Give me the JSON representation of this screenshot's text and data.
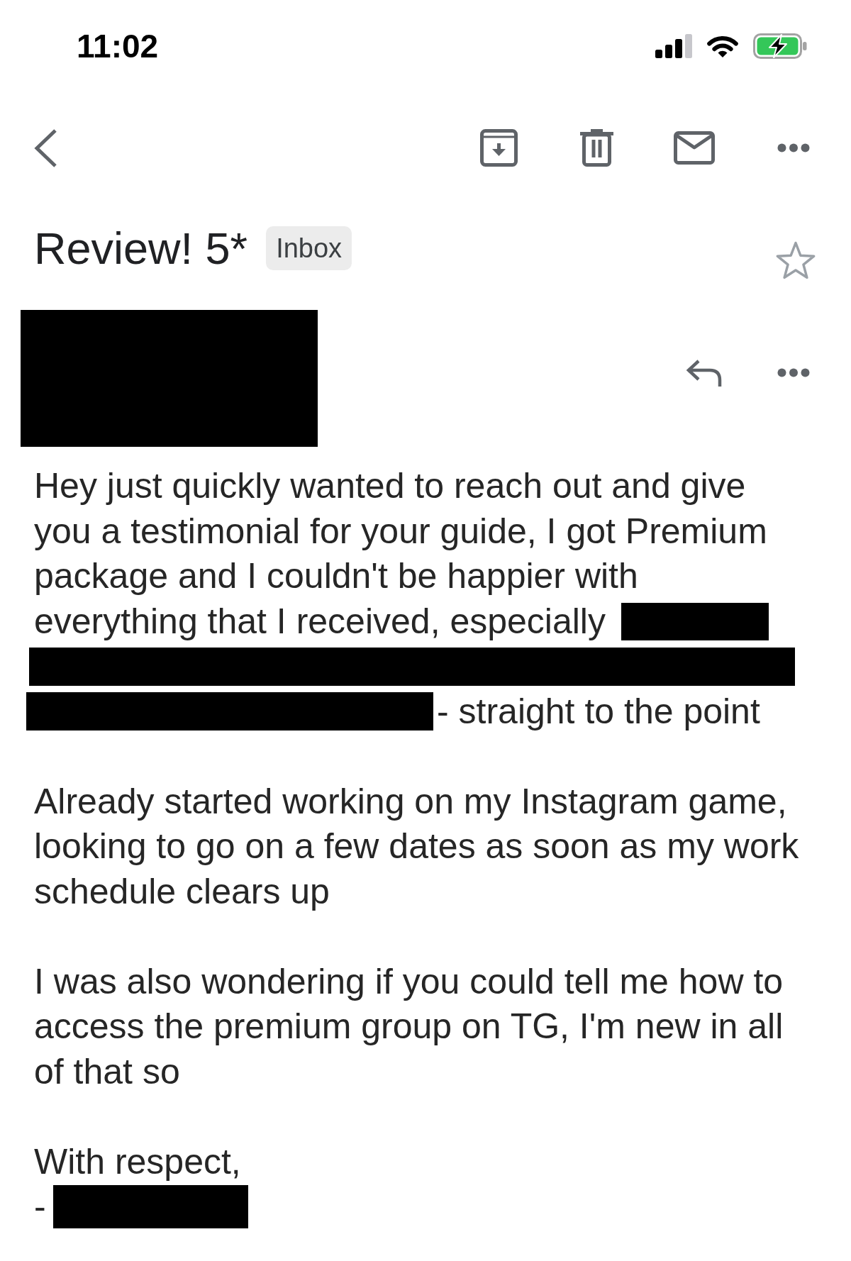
{
  "status_bar": {
    "time": "11:02"
  },
  "header": {
    "subject": "Review! 5*",
    "label": "Inbox",
    "starred": false
  },
  "message": {
    "paragraphs": [
      {
        "kind": "redacted",
        "text_before": "Hey just quickly wanted to reach out and give\nyou a testimonial for your guide, I got Premium\npackage and I couldn't be happier with\neverything that I received, especially",
        "text_after": "- straight to the point"
      },
      {
        "kind": "plain",
        "text": "Already started working on my Instagram game,\nlooking to go on a few dates as soon as my work\nschedule clears up"
      },
      {
        "kind": "plain",
        "text": "I was also wondering if you could tell me how to\naccess the premium group on TG, I'm new in all\nof that so"
      }
    ],
    "signature": {
      "closing": "With respect,",
      "prefix": "-"
    }
  }
}
